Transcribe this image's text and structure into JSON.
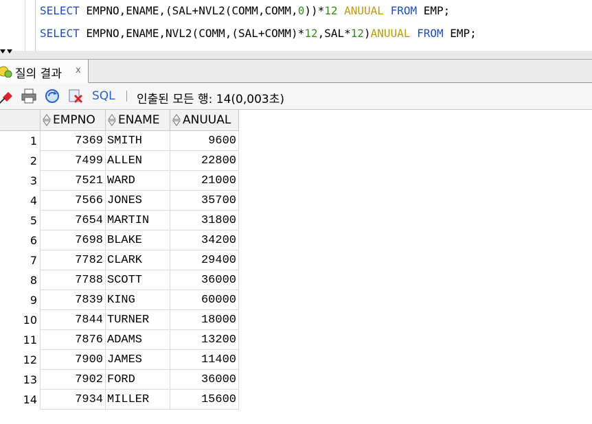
{
  "editor": {
    "line1": {
      "kw_select": "SELECT",
      "seg1": " EMPNO,ENAME,(SAL+NVL2(COMM,COMM,",
      "num0": "0",
      "seg2": "))*",
      "num12": "12",
      "seg3": " ",
      "alias": "ANUUAL",
      "seg4": " ",
      "kw_from": "FROM",
      "seg5": " EMP;"
    },
    "line2": {
      "kw_select": "SELECT",
      "seg1": " EMPNO,ENAME,NVL2(COMM,(SAL+COMM)*",
      "num12a": "12",
      "seg2": ",SAL*",
      "num12b": "12",
      "seg3": ")",
      "alias": "ANUUAL",
      "seg4": " ",
      "kw_from": "FROM",
      "seg5": " EMP;"
    }
  },
  "result_tab": {
    "label": "질의 결과",
    "close": "x"
  },
  "toolbar": {
    "sql_label": "SQL",
    "status": "인출된 모든 행: 14(0,003초)",
    "icons": [
      "pin-icon",
      "print-icon",
      "refresh-icon",
      "delete-icon"
    ]
  },
  "grid": {
    "columns": [
      "EMPNO",
      "ENAME",
      "ANUUAL"
    ],
    "rows": [
      {
        "n": "1",
        "empno": "7369",
        "ename": "SMITH",
        "anuual": "9600"
      },
      {
        "n": "2",
        "empno": "7499",
        "ename": "ALLEN",
        "anuual": "22800"
      },
      {
        "n": "3",
        "empno": "7521",
        "ename": "WARD",
        "anuual": "21000"
      },
      {
        "n": "4",
        "empno": "7566",
        "ename": "JONES",
        "anuual": "35700"
      },
      {
        "n": "5",
        "empno": "7654",
        "ename": "MARTIN",
        "anuual": "31800"
      },
      {
        "n": "6",
        "empno": "7698",
        "ename": "BLAKE",
        "anuual": "34200"
      },
      {
        "n": "7",
        "empno": "7782",
        "ename": "CLARK",
        "anuual": "29400"
      },
      {
        "n": "8",
        "empno": "7788",
        "ename": "SCOTT",
        "anuual": "36000"
      },
      {
        "n": "9",
        "empno": "7839",
        "ename": "KING",
        "anuual": "60000"
      },
      {
        "n": "10",
        "empno": "7844",
        "ename": "TURNER",
        "anuual": "18000"
      },
      {
        "n": "11",
        "empno": "7876",
        "ename": "ADAMS",
        "anuual": "13200"
      },
      {
        "n": "12",
        "empno": "7900",
        "ename": "JAMES",
        "anuual": "11400"
      },
      {
        "n": "13",
        "empno": "7902",
        "ename": "FORD",
        "anuual": "36000"
      },
      {
        "n": "14",
        "empno": "7934",
        "ename": "MILLER",
        "anuual": "15600"
      }
    ]
  },
  "colors": {
    "keyword": "#1f4fb5",
    "number": "#3a8a26",
    "alias": "#b89b10",
    "sql_link": "#2a62c9"
  }
}
